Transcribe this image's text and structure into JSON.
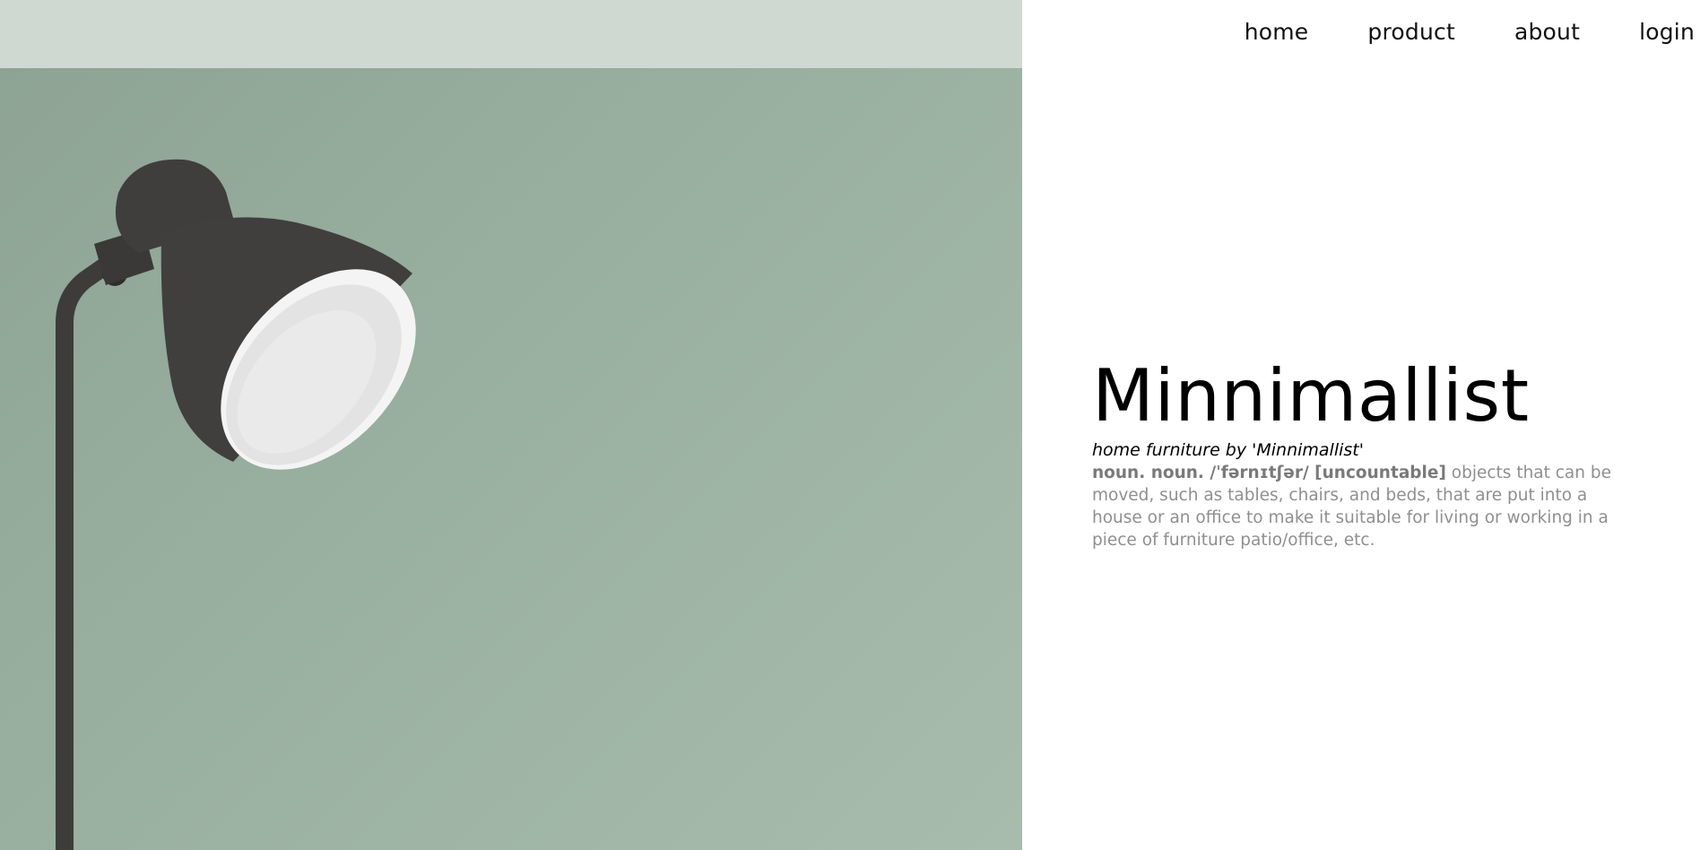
{
  "nav": {
    "items": [
      {
        "label": "home"
      },
      {
        "label": "product"
      },
      {
        "label": "about"
      },
      {
        "label": "login"
      }
    ]
  },
  "hero": {
    "title": "Minnimallist",
    "subtitle": "home furniture by 'Minnimallist'",
    "definition_term": "noun. noun. /ˈfərnɪtʃər/ [uncountable]",
    "definition_text": " objects that can be moved, such as tables, chairs, and beds, that are put into a house or an office to make it suitable for living or working in a piece of furniture patio/office, etc."
  },
  "image": {
    "subject": "floor-lamp-icon",
    "colors": {
      "wall": "#97ad9d",
      "top_band": "#cfd8d1",
      "lamp": "#3c3b3a",
      "lamp_inner": "#eeeeee"
    }
  }
}
